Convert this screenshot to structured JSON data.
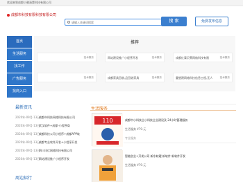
{
  "topbar": {
    "text": "欢迎来到成都小赖清楚科技有限公司"
  },
  "logo": {
    "text": "成都市科技有限科技有限公司"
  },
  "search": {
    "placeholder": "请输入关键词搜索",
    "button_label": "搜 索"
  },
  "publish": {
    "label": "免费发布信息"
  },
  "nav": {
    "items": [
      "首页",
      "生活服务",
      "找工作",
      "广告服务",
      "找商入口"
    ]
  },
  "recommend": {
    "title": "推荐",
    "cards": [
      {
        "title": "",
        "tag": "技术服务"
      },
      {
        "title": "网站建设推广小程序开发",
        "tag": "技术服务"
      },
      {
        "title": "成都红泰贝莱网络科技有限",
        "tag": "技术服务"
      },
      {
        "title": "",
        "tag": "技术服务"
      },
      {
        "title": "成都家具回收,品回收家具",
        "tag": "技术服务"
      },
      {
        "title": "重塑建网络科技信息工程,无人",
        "tag": "技术服务"
      }
    ]
  },
  "news": {
    "title": "最新资讯",
    "items": [
      {
        "date": "2020年-09月-13日",
        "text": "成都市科技网络科技有限公司"
      },
      {
        "date": "2020年-09月-13日",
        "text": "武汉软件+成都-小程序商"
      },
      {
        "date": "2020年-09月-13日",
        "text": "成都科技公司小程序+成都APP软"
      },
      {
        "date": "2020年-09月-13日",
        "text": "成都专业软件开发+小程序开发"
      },
      {
        "date": "2020年-09月-13日",
        "text": "四川讯亿网络科技有限公司"
      },
      {
        "date": "2020年-09月-13日",
        "text": "网站建设推广小程序开发"
      }
    ]
  },
  "recruit": {
    "title": "周边招行"
  },
  "services": {
    "title": "生活服务",
    "items": [
      {
        "image_icon": "110-banner-image",
        "name": "成都中小科技企小科技企业建设及 24小时管理服务",
        "row": "生活服务    ¥79-元",
        "desc": "专业服务"
      },
      {
        "image_icon": "worker-photo-image",
        "name": "智能创业+开发公司 新东软硬 新软件 新软件开发",
        "row": "生活服务    ¥79-元",
        "desc": ""
      }
    ]
  }
}
